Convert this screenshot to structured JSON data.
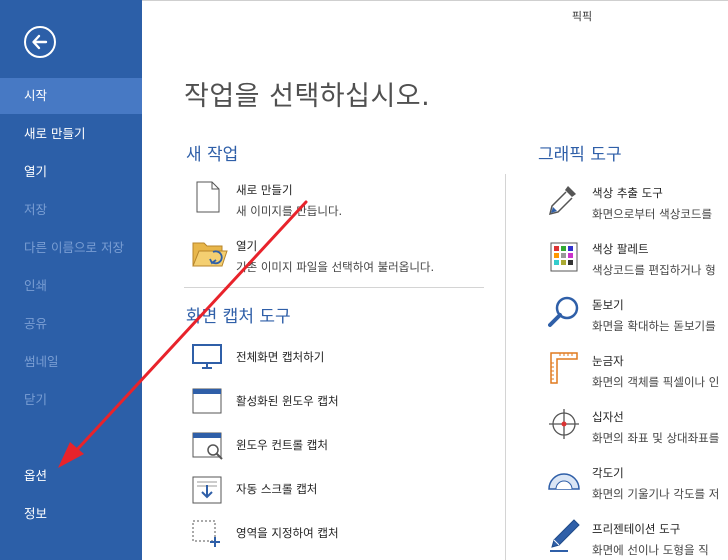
{
  "app": {
    "title": "픽픽"
  },
  "sidebar": {
    "items": [
      {
        "label": "시작",
        "state": "active"
      },
      {
        "label": "새로 만들기",
        "state": "enabled"
      },
      {
        "label": "열기",
        "state": "enabled"
      },
      {
        "label": "저장",
        "state": "disabled"
      },
      {
        "label": "다른 이름으로 저장",
        "state": "disabled"
      },
      {
        "label": "인쇄",
        "state": "disabled"
      },
      {
        "label": "공유",
        "state": "disabled"
      },
      {
        "label": "썸네일",
        "state": "disabled"
      },
      {
        "label": "닫기",
        "state": "disabled"
      },
      {
        "label": "옵션",
        "state": "enabled"
      },
      {
        "label": "정보",
        "state": "enabled"
      }
    ]
  },
  "main": {
    "heading": "작업을 선택하십시오.",
    "new_task": {
      "title": "새 작업",
      "items": [
        {
          "title": "새로 만들기",
          "desc": "새 이미지를 만듭니다.",
          "icon": "new-file-icon"
        },
        {
          "title": "열기",
          "desc": "기존 이미지 파일을 선택하여 불러옵니다.",
          "icon": "open-folder-icon"
        }
      ]
    },
    "capture": {
      "title": "화면 캡처 도구",
      "items": [
        {
          "label": "전체화면 캡처하기",
          "icon": "fullscreen-capture-icon"
        },
        {
          "label": "활성화된 윈도우 캡처",
          "icon": "active-window-capture-icon"
        },
        {
          "label": "윈도우 컨트롤 캡처",
          "icon": "window-control-capture-icon"
        },
        {
          "label": "자동 스크롤 캡처",
          "icon": "scroll-capture-icon"
        },
        {
          "label": "영역을 지정하여 캡처",
          "icon": "region-capture-icon"
        }
      ]
    },
    "graphic": {
      "title": "그래픽 도구",
      "items": [
        {
          "title": "색상 추출 도구",
          "desc": "화면으로부터 색상코드를",
          "icon": "eyedropper-icon"
        },
        {
          "title": "색상 팔레트",
          "desc": "색상코드를 편집하거나 형",
          "icon": "palette-icon"
        },
        {
          "title": "돋보기",
          "desc": "화면을 확대하는 돋보기를",
          "icon": "magnifier-icon"
        },
        {
          "title": "눈금자",
          "desc": "화면의 객체를 픽셀이나 인",
          "icon": "ruler-icon"
        },
        {
          "title": "십자선",
          "desc": "화면의 좌표 및 상대좌표를",
          "icon": "crosshair-icon"
        },
        {
          "title": "각도기",
          "desc": "화면의 기울기나 각도를 저",
          "icon": "protractor-icon"
        },
        {
          "title": "프리젠테이션 도구",
          "desc": "화면에 선이나 도형을 직",
          "icon": "pen-icon"
        }
      ]
    }
  },
  "colors": {
    "sidebar": "#2c5fa8",
    "sidebar_active": "#4779c4",
    "sidebar_disabled_text": "#7a9ed3",
    "section_title": "#2f5fa8",
    "annotation_arrow": "#e8232b"
  }
}
